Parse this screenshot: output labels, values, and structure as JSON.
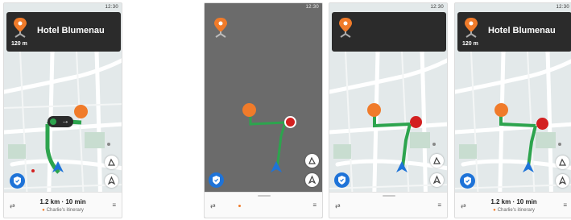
{
  "colors": {
    "route": "#2da44e",
    "accent": "#f07b2a",
    "header_bg": "#2b2b2b",
    "stop_red": "#d32020",
    "shield_blue": "#1e73d8"
  },
  "screens": [
    {
      "time": "12:30",
      "destination": "Hotel Blumenau",
      "distance": "120 m",
      "summary": "1.2 km · 10 min",
      "itinerary": "Charlie's itinerary"
    },
    {
      "time": "12:30"
    },
    {
      "time": "12:30"
    },
    {
      "time": "12:30",
      "destination": "Hotel Blumenau",
      "distance": "120 m",
      "summary": "1.2 km · 10 min",
      "itinerary": "Charlie's itinerary"
    }
  ],
  "icons": {
    "shield": "shield-icon",
    "pin": "location-pin-icon",
    "arrow": "navigation-arrow-icon",
    "layers": "route-options-icon",
    "compass": "north-arrow-icon",
    "filter": "filter-icon",
    "menu": "menu-icon"
  }
}
